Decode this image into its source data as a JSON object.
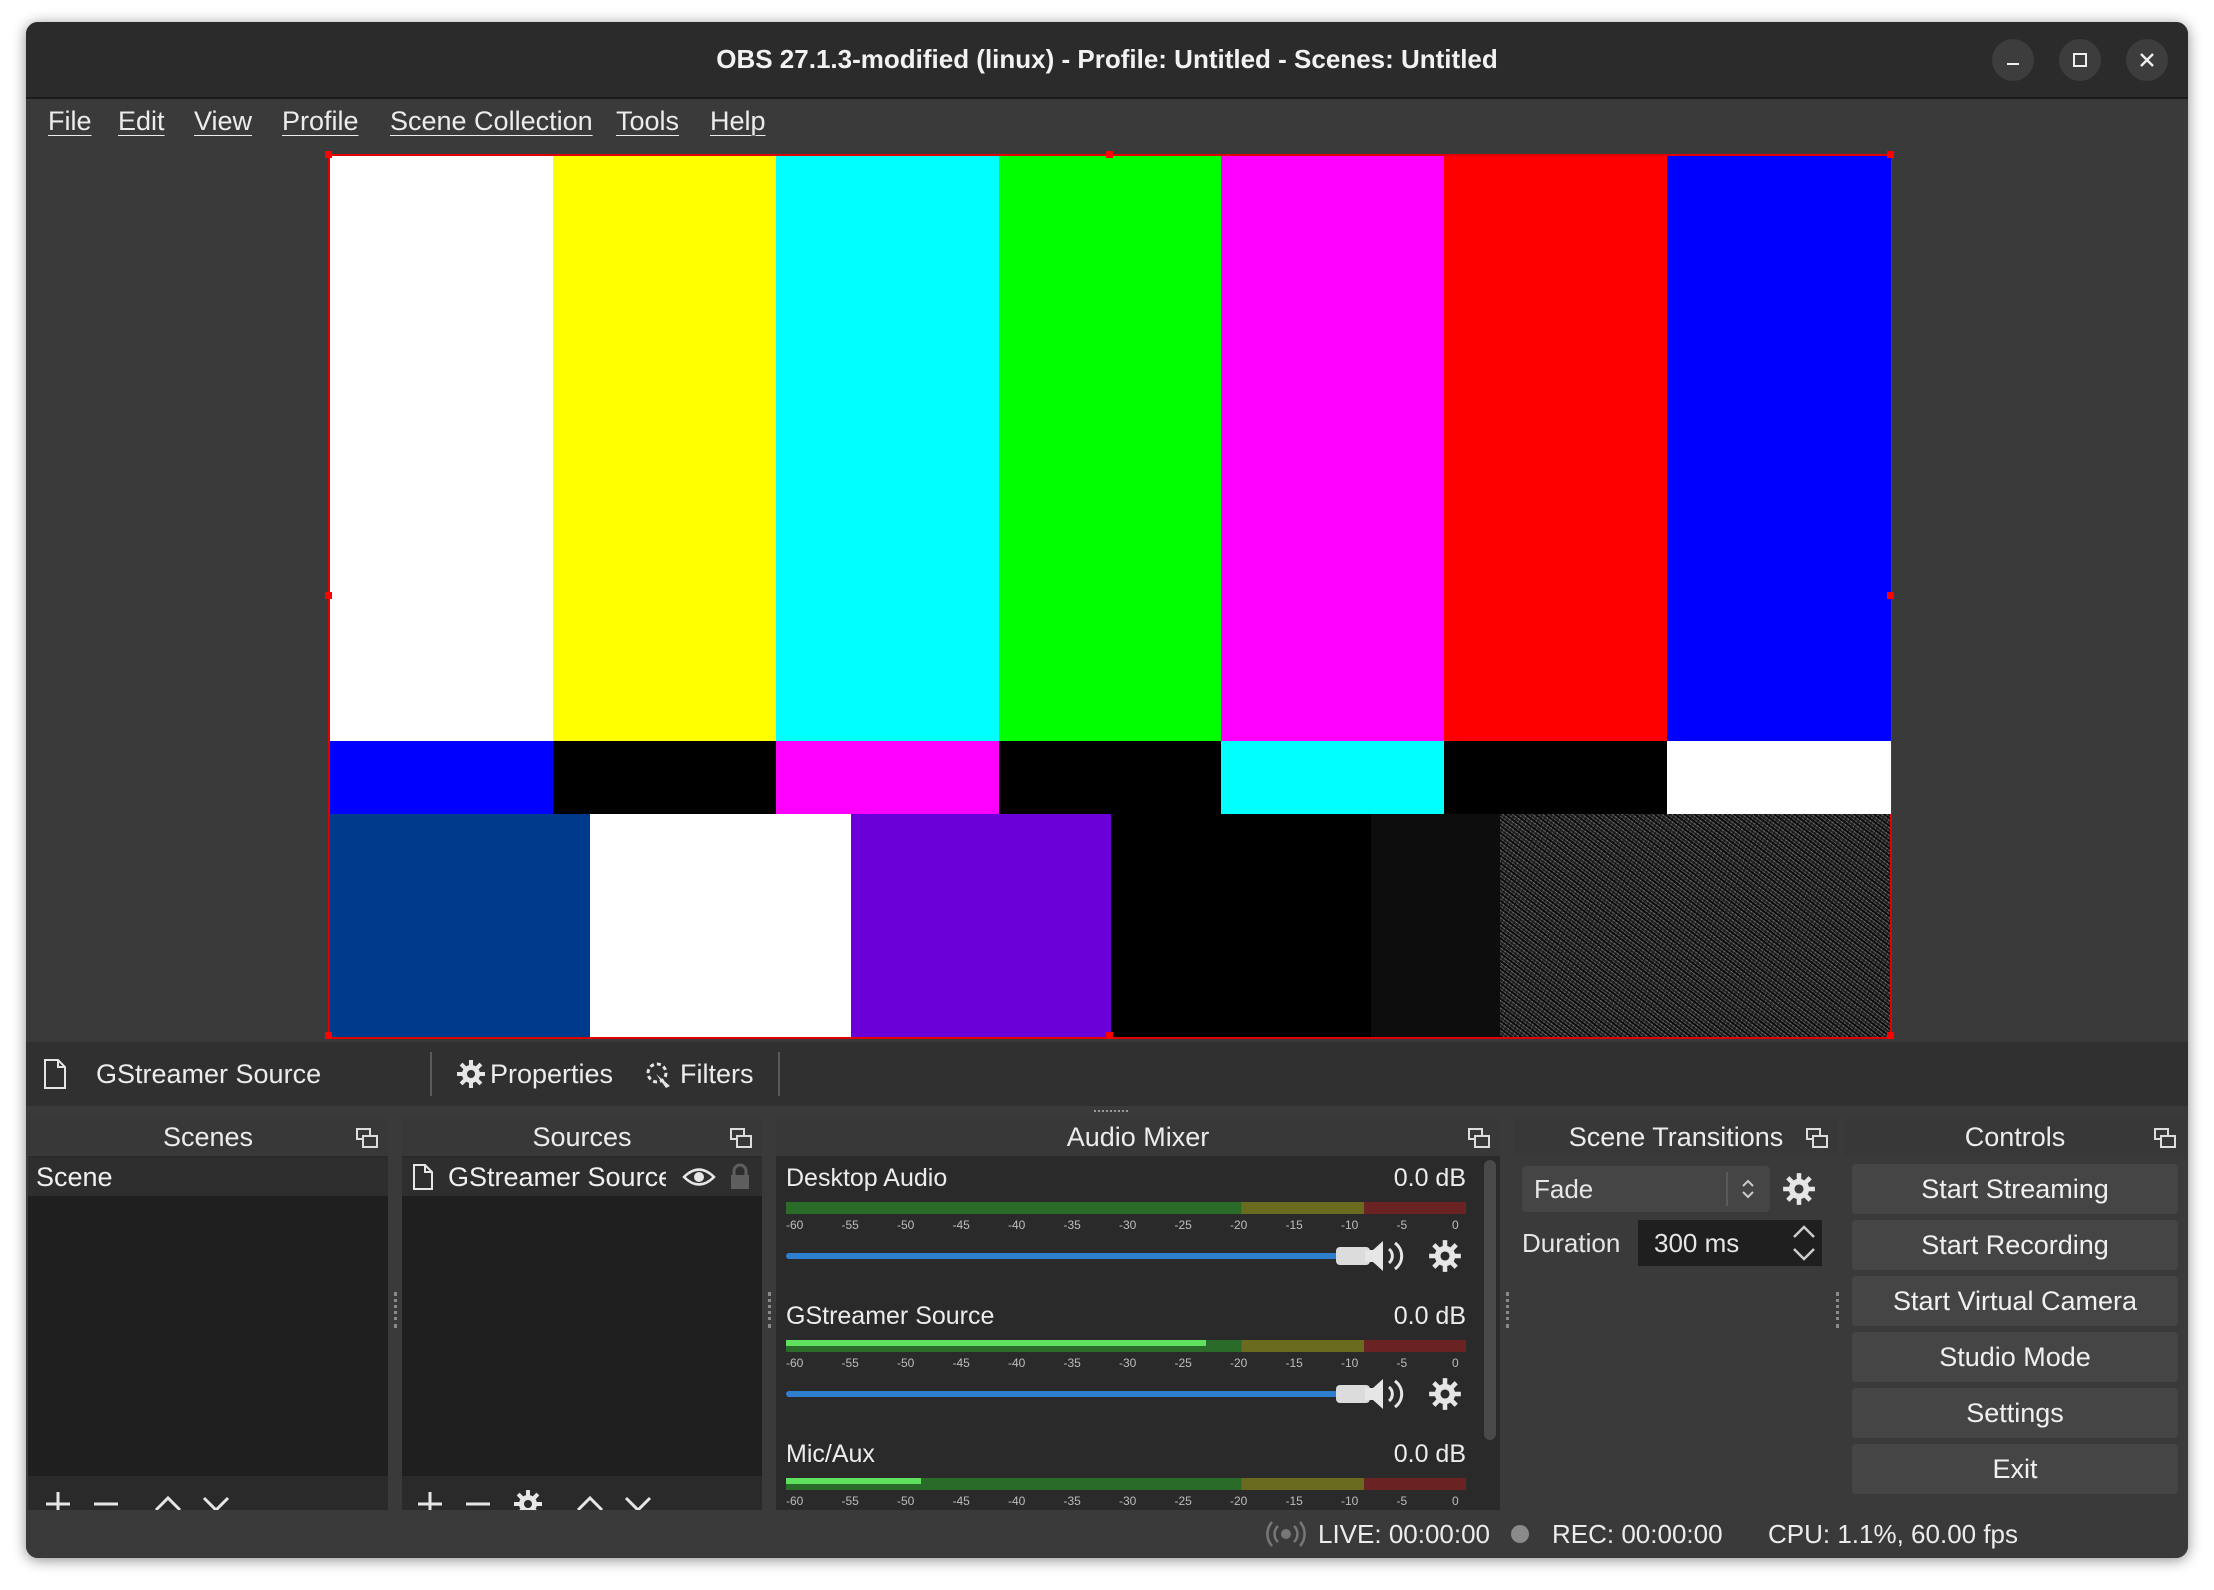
{
  "window": {
    "title": "OBS 27.1.3-modified (linux) - Profile: Untitled - Scenes: Untitled",
    "controls": [
      "minimize-icon",
      "maximize-icon",
      "close-icon"
    ]
  },
  "menu": [
    "File",
    "Edit",
    "View",
    "Profile",
    "Scene Collection",
    "Tools",
    "Help"
  ],
  "preview": {
    "top_bars": [
      "#ffffff",
      "#ffff00",
      "#00ffff",
      "#00ff00",
      "#ff00ff",
      "#ff0000",
      "#0000ff"
    ],
    "mid_bars": [
      "#0000ff",
      "#000000",
      "#ff00ff",
      "#000000",
      "#00ffff",
      "#000000",
      "#ffffff"
    ],
    "bottom_bars": [
      "#003a8c",
      "#ffffff",
      "#6c00d8",
      "#000000",
      "#0d0d0d",
      "noise"
    ],
    "selection_color": "#e00000"
  },
  "source_toolbar": {
    "source_name": "GStreamer Source",
    "properties_label": "Properties",
    "filters_label": "Filters"
  },
  "scenes": {
    "title": "Scenes",
    "items": [
      "Scene"
    ]
  },
  "sources": {
    "title": "Sources",
    "items": [
      "GStreamer Source"
    ]
  },
  "audio_mixer": {
    "title": "Audio Mixer",
    "ticks": [
      "-60",
      "-55",
      "-50",
      "-45",
      "-40",
      "-35",
      "-30",
      "-25",
      "-20",
      "-15",
      "-10",
      "-5",
      "0"
    ],
    "channels": [
      {
        "name": "Desktop Audio",
        "db": "0.0 dB",
        "volume": 1.0
      },
      {
        "name": "GStreamer Source",
        "db": "0.0 dB",
        "volume": 1.0
      },
      {
        "name": "Mic/Aux",
        "db": "0.0 dB",
        "volume": 1.0
      }
    ]
  },
  "transitions": {
    "title": "Scene Transitions",
    "selected": "Fade",
    "duration_label": "Duration",
    "duration_value": "300 ms"
  },
  "controls": {
    "title": "Controls",
    "buttons": [
      "Start Streaming",
      "Start Recording",
      "Start Virtual Camera",
      "Studio Mode",
      "Settings",
      "Exit"
    ]
  },
  "status": {
    "live": "LIVE: 00:00:00",
    "rec": "REC: 00:00:00",
    "cpu": "CPU: 1.1%, 60.00 fps"
  }
}
